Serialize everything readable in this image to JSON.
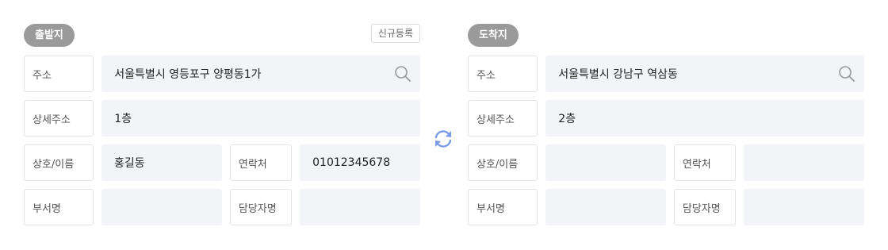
{
  "origin": {
    "badge": "출발지",
    "new_button": "신규등록",
    "address_label": "주소",
    "address_value": "서울특별시 영등포구 양평동1가",
    "detail_label": "상세주소",
    "detail_value": "1층",
    "name_label": "상호/이름",
    "name_value": "홍길동",
    "contact_label": "연락처",
    "contact_value": "01012345678",
    "dept_label": "부서명",
    "dept_value": "",
    "manager_label": "담당자명",
    "manager_value": ""
  },
  "destination": {
    "badge": "도착지",
    "address_label": "주소",
    "address_value": "서울특별시 강남구 역삼동",
    "detail_label": "상세주소",
    "detail_value": "2층",
    "name_label": "상호/이름",
    "name_value": "",
    "contact_label": "연락처",
    "contact_value": "",
    "dept_label": "부서명",
    "dept_value": "",
    "manager_label": "담당자명",
    "manager_value": ""
  },
  "icons": {
    "search": "search-icon",
    "swap": "swap-arrows-icon"
  },
  "colors": {
    "badge": "#9a9a9a",
    "field_bg": "#f2f4f7",
    "swap": "#7b9be8"
  }
}
